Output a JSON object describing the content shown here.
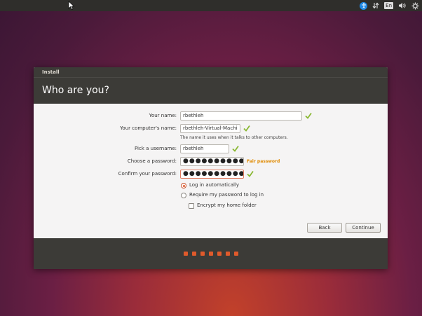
{
  "topbar": {
    "tray": {
      "accessibility_icon": "accessibility-icon",
      "network_icon": "network-arrows-icon",
      "keyboard_layout": "En",
      "volume_icon": "volume-icon",
      "settings_icon": "gear-icon"
    }
  },
  "window": {
    "title": "Install",
    "heading": "Who are you?"
  },
  "form": {
    "your_name_label": "Your name:",
    "your_name_value": "rbethleh",
    "computer_name_label": "Your computer's name:",
    "computer_name_value": "rbethleh-Virtual-Machi",
    "computer_name_hint": "The name it uses when it talks to other computers.",
    "username_label": "Pick a username:",
    "username_value": "rbethleh",
    "password_label": "Choose a password:",
    "password_value": "●●●●●●●●●●●",
    "password_strength": "Fair password",
    "confirm_label": "Confirm your password:",
    "confirm_value": "●●●●●●●●●●●",
    "options": {
      "login_auto": "Log in automatically",
      "require_password": "Require my password to log in",
      "encrypt_home": "Encrypt my home folder"
    },
    "selected_option": "login_auto"
  },
  "buttons": {
    "back": "Back",
    "continue": "Continue"
  },
  "progress": {
    "steps": 7
  },
  "colors": {
    "accent": "#e05a2b",
    "check_green": "#8ab833",
    "warning": "#e08a00",
    "chrome": "#3c3b37"
  }
}
